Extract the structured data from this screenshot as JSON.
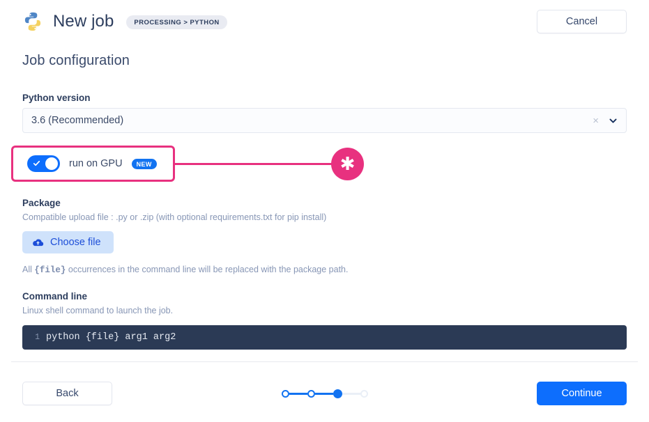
{
  "header": {
    "logo_icon": "python-logo-icon",
    "title": "New job",
    "breadcrumb_badge": "PROCESSING > PYTHON",
    "cancel_label": "Cancel"
  },
  "main": {
    "section_title": "Job configuration",
    "python_version": {
      "label": "Python version",
      "value": "3.6 (Recommended)",
      "clear_icon": "×",
      "chevron_icon": "chevron-down-icon"
    },
    "gpu": {
      "label": "run on GPU",
      "badge": "NEW",
      "toggle_state": "on",
      "annotation_glyph": "✱"
    },
    "package": {
      "title": "Package",
      "help": "Compatible upload file : .py or .zip (with optional requirements.txt for pip install)",
      "choose_file_label": "Choose file",
      "choose_file_icon": "cloud-upload-icon",
      "note_prefix": "All ",
      "note_code": "{file}",
      "note_suffix": " occurrences in the command line will be replaced with the package path."
    },
    "command_line": {
      "title": "Command line",
      "help": "Linux shell command to launch the job.",
      "line_number": "1",
      "code": "python {file} arg1 arg2"
    }
  },
  "footer": {
    "back_label": "Back",
    "continue_label": "Continue",
    "steps_total": 4,
    "steps_current": 3
  },
  "colors": {
    "primary_blue": "#0d6efd",
    "accent_pink": "#e8317f",
    "editor_bg": "#2b3a55",
    "text_navy": "#2d3e5e",
    "muted": "#8796b5"
  }
}
